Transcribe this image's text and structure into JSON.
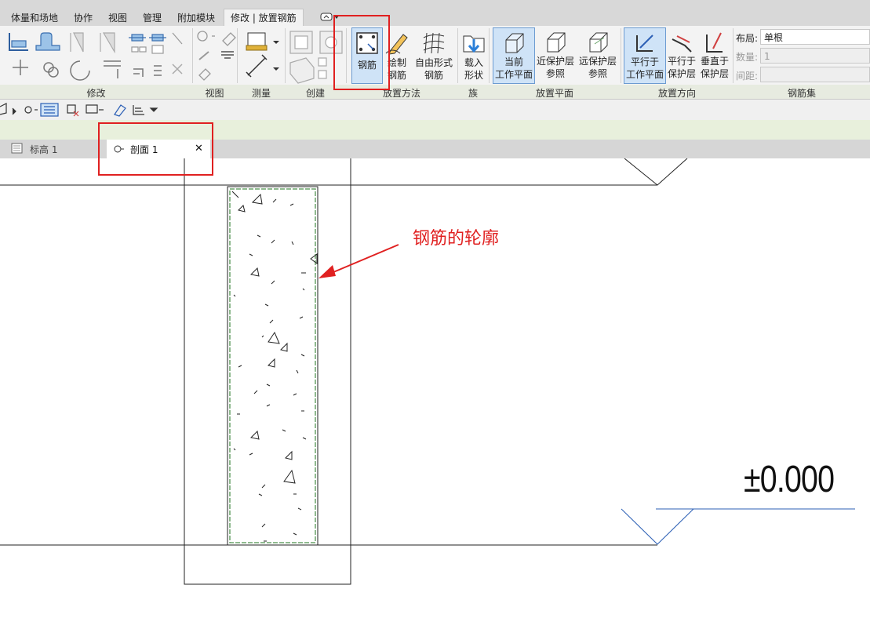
{
  "menu": {
    "tabs": [
      "体量和场地",
      "协作",
      "视图",
      "管理",
      "附加模块",
      "修改 | 放置钢筋"
    ]
  },
  "ribbon": {
    "panels": {
      "modify": "修改",
      "view": "视图",
      "measure": "测量",
      "create": "创建",
      "placement_method": "放置方法",
      "family": "族",
      "placement_plane": "放置平面",
      "placement_orientation": "放置方向",
      "rebar_set": "钢筋集"
    },
    "buttons": {
      "rebar": "钢筋",
      "sketch_rebar_1": "绘制",
      "sketch_rebar_2": "钢筋",
      "free_form_1": "自由形式",
      "free_form_2": "钢筋",
      "load_shapes_1": "载入",
      "load_shapes_2": "形状",
      "current_wp_1": "当前",
      "current_wp_2": "工作平面",
      "near_cover_1": "近保护层",
      "near_cover_2": "参照",
      "far_cover_1": "远保护层",
      "far_cover_2": "参照",
      "parallel_wp_1": "平行于",
      "parallel_wp_2": "工作平面",
      "parallel_cover_1": "平行于",
      "parallel_cover_2": "保护层",
      "perp_cover_1": "垂直于",
      "perp_cover_2": "保护层"
    },
    "rebar_set": {
      "layout_label": "布局:",
      "layout_value": "单根",
      "quantity_label": "数量:",
      "quantity_value": "1",
      "spacing_label": "间距:",
      "spacing_value": ""
    }
  },
  "view_tabs": {
    "level": "标高 1",
    "section": "剖面 1",
    "close": "✕"
  },
  "canvas": {
    "annotation": "钢筋的轮廓",
    "elevation": "±0.000"
  },
  "colors": {
    "highlight": "#e02020",
    "accent_blue": "#2b5fb5",
    "rebar_outline": "#6aa36a"
  }
}
